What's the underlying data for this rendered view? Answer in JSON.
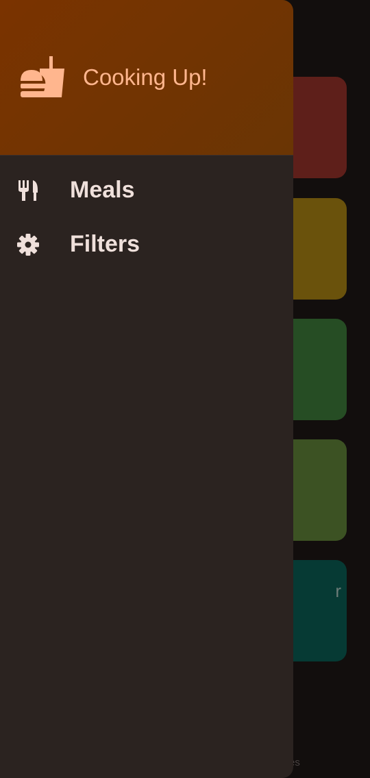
{
  "drawer": {
    "header": {
      "title": "Cooking Up!",
      "icon": "fastfood-icon"
    },
    "items": [
      {
        "label": "Meals",
        "icon": "restaurant-icon"
      },
      {
        "label": "Filters",
        "icon": "settings-icon"
      }
    ]
  },
  "background": {
    "card_partial_text": "r",
    "bottom_partial_text": "es"
  },
  "colors": {
    "drawer_bg": "#2b2320",
    "header_bg": "#7a3300",
    "accent": "#ffb68e",
    "label": "#efe0db"
  }
}
